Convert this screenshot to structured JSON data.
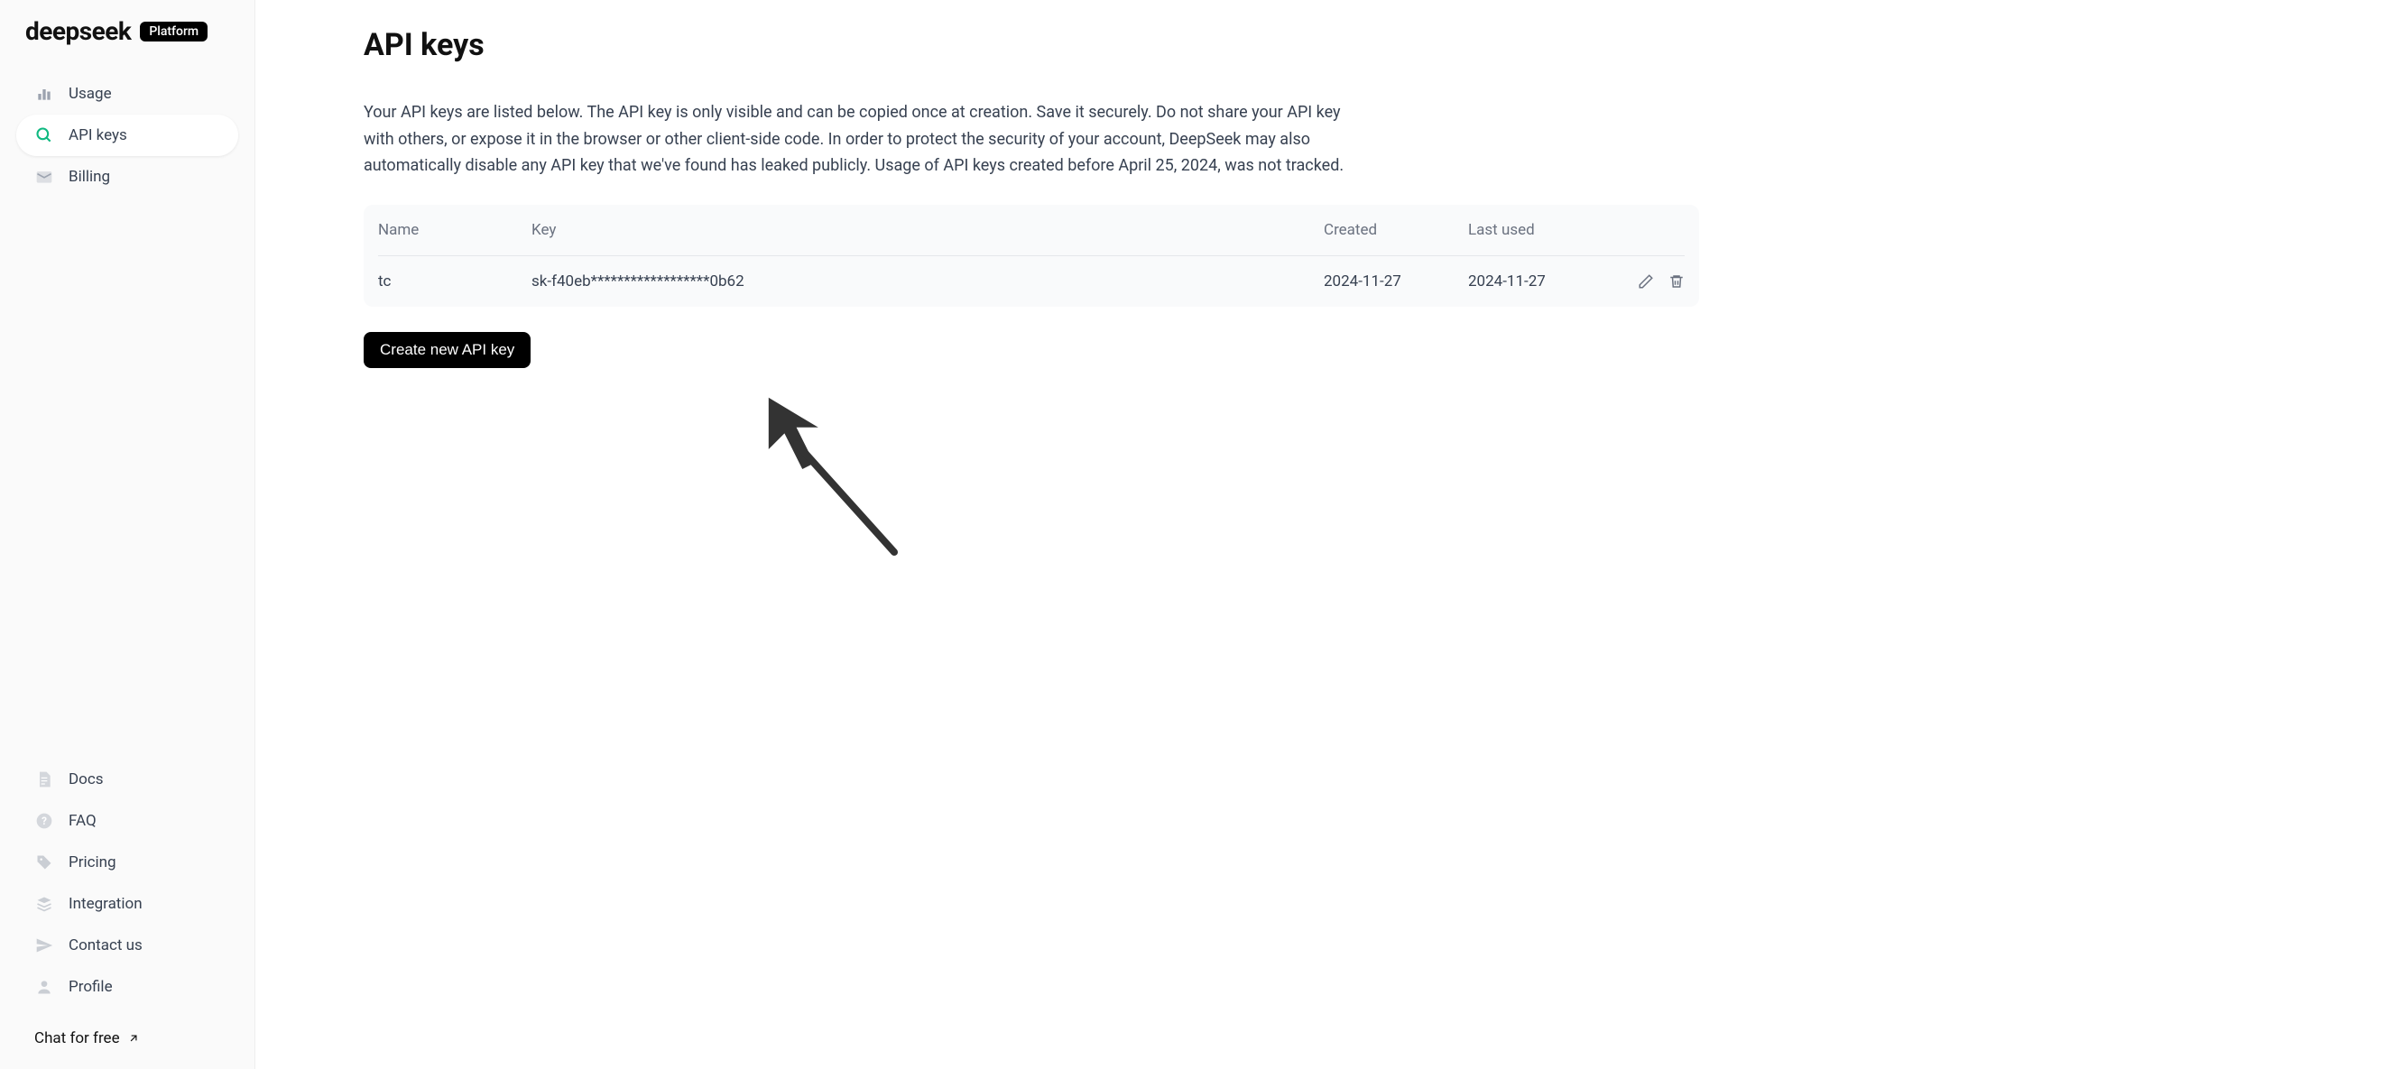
{
  "brand": {
    "name": "deepseek",
    "badge": "Platform"
  },
  "sidebar": {
    "primary": [
      {
        "label": "Usage",
        "icon": "bar-chart-icon",
        "active": false
      },
      {
        "label": "API keys",
        "icon": "search-icon",
        "active": true
      },
      {
        "label": "Billing",
        "icon": "mail-icon",
        "active": false
      }
    ],
    "secondary": [
      {
        "label": "Docs",
        "icon": "document-icon"
      },
      {
        "label": "FAQ",
        "icon": "question-icon"
      },
      {
        "label": "Pricing",
        "icon": "tag-icon"
      },
      {
        "label": "Integration",
        "icon": "stack-icon"
      },
      {
        "label": "Contact us",
        "icon": "send-icon"
      },
      {
        "label": "Profile",
        "icon": "user-icon"
      }
    ],
    "chat_free": "Chat for free"
  },
  "page": {
    "title": "API keys",
    "description": "Your API keys are listed below. The API key is only visible and can be copied once at creation. Save it securely. Do not share your API key with others, or expose it in the browser or other client-side code. In order to protect the security of your account, DeepSeek may also automatically disable any API key that we've found has leaked publicly. Usage of API keys created before April 25, 2024, was not tracked."
  },
  "table": {
    "headers": {
      "name": "Name",
      "key": "Key",
      "created": "Created",
      "last_used": "Last used"
    },
    "rows": [
      {
        "name": "tc",
        "key": "sk-f40eb******************0b62",
        "created": "2024-11-27",
        "last_used": "2024-11-27"
      }
    ]
  },
  "actions": {
    "create_label": "Create new API key"
  }
}
